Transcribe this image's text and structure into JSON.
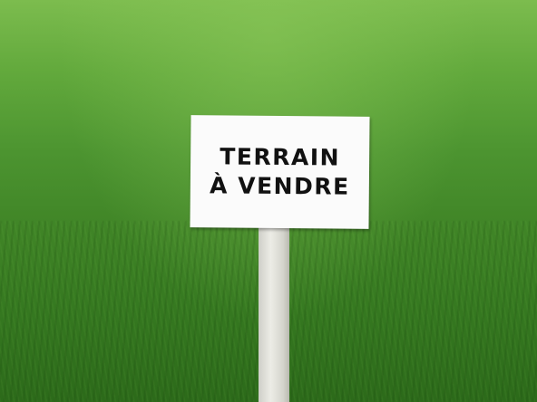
{
  "sign": {
    "line1": "TERRAIN",
    "line2": "À VENDRE"
  },
  "colors": {
    "grass_light": "#7cbc4e",
    "grass_dark": "#2c6a1a",
    "sign": "#fbfbfb",
    "text": "#111111"
  }
}
